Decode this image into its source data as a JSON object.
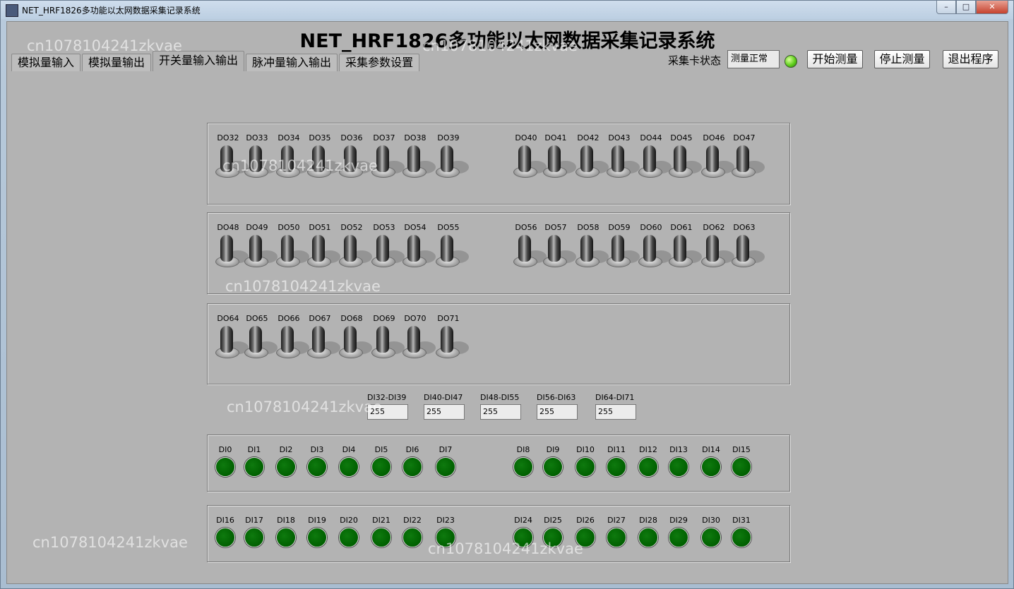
{
  "window": {
    "title": "NET_HRF1826多功能以太网数据采集记录系统",
    "icon": "app-icon",
    "controls": {
      "minimize": "–",
      "maximize": "□",
      "close": "✕"
    }
  },
  "header": {
    "title": "NET_HRF1826多功能以太网数据采集记录系统",
    "status_label": "采集卡状态",
    "status_value": "测量正常",
    "status_led_color": "#5fcf1c",
    "buttons": {
      "start": "开始测量",
      "stop": "停止测量",
      "exit": "退出程序"
    }
  },
  "tabs": [
    {
      "label": "模拟量输入",
      "active": false
    },
    {
      "label": "模拟量输出",
      "active": false
    },
    {
      "label": "开关量输入输出",
      "active": true
    },
    {
      "label": "脉冲量输入输出",
      "active": false
    },
    {
      "label": "采集参数设置",
      "active": false
    }
  ],
  "outputs": {
    "row1": [
      "DO32",
      "DO33",
      "DO34",
      "DO35",
      "DO36",
      "DO37",
      "DO38",
      "DO39",
      "DO40",
      "DO41",
      "DO42",
      "DO43",
      "DO44",
      "DO45",
      "DO46",
      "DO47"
    ],
    "row2": [
      "DO48",
      "DO49",
      "DO50",
      "DO51",
      "DO52",
      "DO53",
      "DO54",
      "DO55",
      "DO56",
      "DO57",
      "DO58",
      "DO59",
      "DO60",
      "DO61",
      "DO62",
      "DO63"
    ],
    "row3": [
      "DO64",
      "DO65",
      "DO66",
      "DO67",
      "DO68",
      "DO69",
      "DO70",
      "DO71"
    ]
  },
  "port_values": [
    {
      "label": "DI32-DI39",
      "value": "255"
    },
    {
      "label": "DI40-DI47",
      "value": "255"
    },
    {
      "label": "DI48-DI55",
      "value": "255"
    },
    {
      "label": "DI56-DI63",
      "value": "255"
    },
    {
      "label": "DI64-DI71",
      "value": "255"
    }
  ],
  "inputs": {
    "row1": [
      "DI0",
      "DI1",
      "DI2",
      "DI3",
      "DI4",
      "DI5",
      "DI6",
      "DI7",
      "DI8",
      "DI9",
      "DI10",
      "DI11",
      "DI12",
      "DI13",
      "DI14",
      "DI15"
    ],
    "row2": [
      "DI16",
      "DI17",
      "DI18",
      "DI19",
      "DI20",
      "DI21",
      "DI22",
      "DI23",
      "DI24",
      "DI25",
      "DI26",
      "DI27",
      "DI28",
      "DI29",
      "DI30",
      "DI31"
    ],
    "led_color": "#006000"
  },
  "watermark": "cn1078104241zkvae"
}
